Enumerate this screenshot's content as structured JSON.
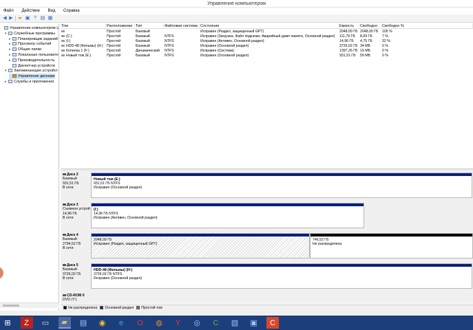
{
  "window": {
    "title": "Управление компьютером"
  },
  "menu": [
    "Файл",
    "Действие",
    "Вид",
    "Справка"
  ],
  "toolbar": {
    "icons": [
      "back-icon",
      "forward-icon",
      "up-folder-icon",
      "properties-icon",
      "help-icon",
      "view-icon",
      "settings-icon"
    ]
  },
  "tree": [
    {
      "label": "Управление компьютером (л",
      "level": 0,
      "exp": "",
      "selected": false
    },
    {
      "label": "Служебные программы",
      "level": 1,
      "exp": "▾",
      "selected": false
    },
    {
      "label": "Планировщик заданий",
      "level": 2,
      "exp": "▸",
      "selected": false
    },
    {
      "label": "Просмотр событий",
      "level": 2,
      "exp": "▸",
      "selected": false
    },
    {
      "label": "Общие папки",
      "level": 2,
      "exp": "▸",
      "selected": false
    },
    {
      "label": "Локальные пользовате",
      "level": 2,
      "exp": "▸",
      "selected": false
    },
    {
      "label": "Производительность",
      "level": 2,
      "exp": "▸",
      "selected": false
    },
    {
      "label": "Диспетчер устройств",
      "level": 2,
      "exp": "",
      "selected": false
    },
    {
      "label": "Запоминающие устройст",
      "level": 1,
      "exp": "▾",
      "selected": false
    },
    {
      "label": "Управление дисками",
      "level": 2,
      "exp": "",
      "selected": true
    },
    {
      "label": "Службы и приложения",
      "level": 1,
      "exp": "▸",
      "selected": false
    }
  ],
  "columns": [
    "Том",
    "Расположение",
    "Тип",
    "Файловая система",
    "Состояние",
    "Емкость",
    "Свободно",
    "Свободно %"
  ],
  "volumes": [
    {
      "name": "",
      "layout": "Простой",
      "type": "Базовый",
      "fs": "",
      "status": "Исправен (Раздел, защищенный GPT)",
      "capacity": "2048,00 ГБ",
      "free": "2048,00 ГБ",
      "free_pct": "100 %"
    },
    {
      "name": "(C:)",
      "layout": "Простой",
      "type": "Базовый",
      "fs": "NTFS",
      "status": "Исправен (Загрузка, Файл подкачки, Аварийный дамп памяти, Основной раздел)",
      "capacity": "111,79 ГБ",
      "free": "8,09 ГБ",
      "free_pct": "7 %"
    },
    {
      "name": "(I:)",
      "layout": "Простой",
      "type": "Базовый",
      "fs": "NTFS",
      "status": "Исправен (Активен, Основной раздел)",
      "capacity": "14,96 ГБ",
      "free": "4,75 ГБ",
      "free_pct": "32 %"
    },
    {
      "name": "HDD-48 (Фильмы) (H:)",
      "layout": "Простой",
      "type": "Базовый",
      "fs": "NTFS",
      "status": "Исправен (Основной раздел)",
      "capacity": "3726,02 ГБ",
      "free": "34 МБ",
      "free_pct": "0 %"
    },
    {
      "name": "Копилка 1 (F:)",
      "layout": "Простой",
      "type": "Динамический",
      "fs": "NTFS",
      "status": "Исправен (Система)",
      "capacity": "1397,26 ГБ",
      "free": "19 МБ",
      "free_pct": "0 %"
    },
    {
      "name": "Новый том (E:)",
      "layout": "Простой",
      "type": "Базовый",
      "fs": "NTFS",
      "status": "Исправен (Основной раздел)",
      "capacity": "931,51 ГБ",
      "free": "59 МБ",
      "free_pct": "0 %"
    }
  ],
  "disks": [
    {
      "name": "Диск 2",
      "kind": "Базовый",
      "size": "931,51 ГБ",
      "state": "В сети",
      "partitions": [
        {
          "name": "Новый том (E:)",
          "line1": "931,51 ГБ NTFS",
          "line2": "Исправен (Основной раздел)"
        }
      ]
    },
    {
      "name": "Диск 3",
      "kind": "Съемное устрой",
      "size": "14,96 ГБ",
      "state": "В сети",
      "partitions": [
        {
          "name": "(I:)",
          "line1": "14,96 ГБ NTFS",
          "line2": "Исправен (Активен, Основной раздел)"
        }
      ]
    },
    {
      "name": "Диск 4",
      "kind": "Базовый",
      "size": "2794,52 ГБ",
      "state": "В сети",
      "partitions": [
        {
          "name": "",
          "line1": "2048,00 ГБ",
          "line2": "Исправен (Раздел, защищенный GPT)"
        },
        {
          "name": "",
          "line1": "746,52 ГБ",
          "line2": "Не распределена"
        }
      ]
    },
    {
      "name": "Диск 5",
      "kind": "Базовый",
      "size": "3726,02 ГБ",
      "state": "В сети",
      "partitions": [
        {
          "name": "HDD-48 (Фильмы) (H:)",
          "line1": "3726,02 ГБ NTFS",
          "line2": "Исправен (Основной раздел)"
        }
      ]
    },
    {
      "name": "CD-ROM 0",
      "kind": "DVD (Y:)",
      "size": "",
      "state": "",
      "partitions": []
    }
  ],
  "legend": [
    {
      "label": "Не распределена",
      "color": "#000000"
    },
    {
      "label": "Основной раздел",
      "color": "#0a1f7a"
    },
    {
      "label": "Простой том",
      "color": "#7b7b2a"
    }
  ],
  "taskbar": [
    "windows-icon",
    "filezilla-icon",
    "terminal-icon",
    "explorer-icon",
    "file-manager-icon",
    "chrome-icon",
    "ie-icon",
    "opera-icon",
    "firefox-icon",
    "yandex-icon",
    "network-icon",
    "camtasia-icon",
    "tool-icon",
    "app-icon",
    "filezilla-red-icon"
  ]
}
